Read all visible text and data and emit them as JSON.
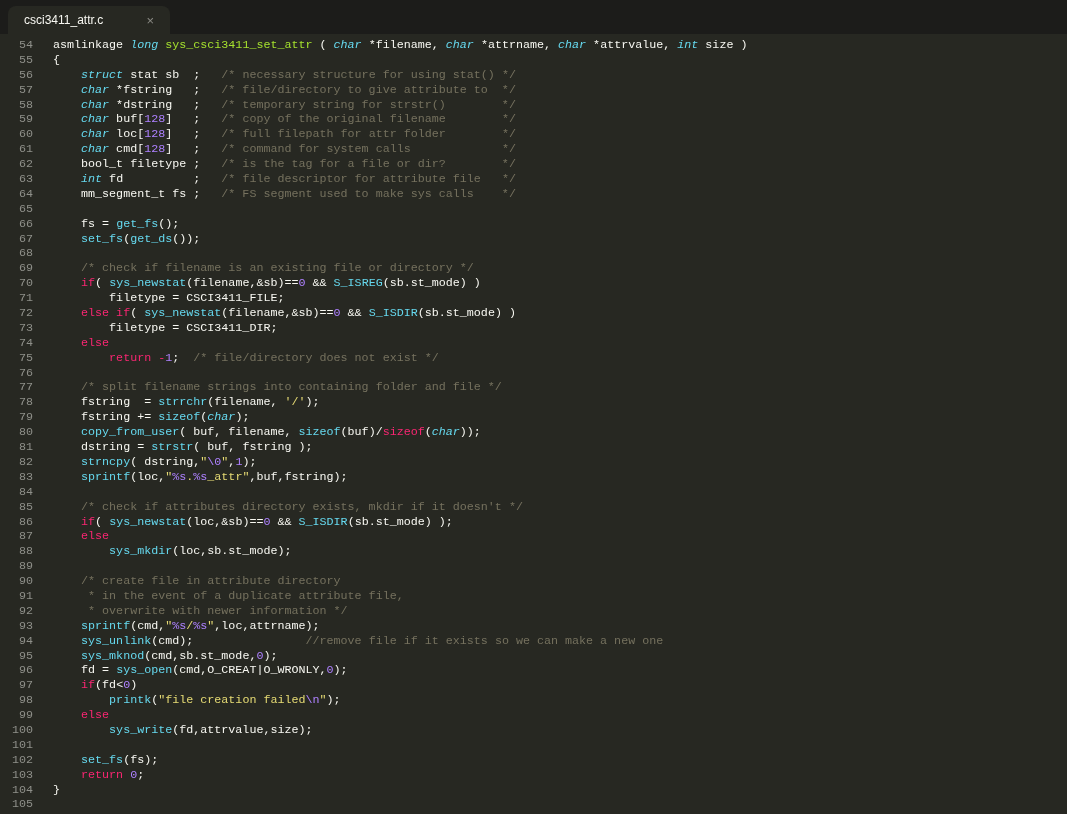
{
  "tabs": [
    {
      "label": "csci3411_attr.c",
      "close": "×",
      "selected": true
    }
  ],
  "lines": [
    {
      "number": "54",
      "tokens": [
        {
          "kind": "plain",
          "text": "asmlinkage "
        },
        {
          "kind": "storage",
          "text": "long "
        },
        {
          "kind": "entity",
          "text": "sys_csci3411_set_attr"
        },
        {
          "kind": "plain",
          "text": " ( "
        },
        {
          "kind": "storage",
          "text": "char"
        },
        {
          "kind": "plain",
          "text": " *filename, "
        },
        {
          "kind": "storage",
          "text": "char"
        },
        {
          "kind": "plain",
          "text": " *attrname, "
        },
        {
          "kind": "storage",
          "text": "char"
        },
        {
          "kind": "plain",
          "text": " *attrvalue, "
        },
        {
          "kind": "storage",
          "text": "int"
        },
        {
          "kind": "plain",
          "text": " size )"
        }
      ]
    },
    {
      "number": "55",
      "tokens": [
        {
          "kind": "plain",
          "text": "{"
        }
      ]
    },
    {
      "number": "56",
      "tokens": [
        {
          "kind": "storage",
          "text": "    struct"
        },
        {
          "kind": "plain",
          "text": " stat sb  ;   "
        },
        {
          "kind": "comment",
          "text": "/* necessary structure for using stat() */"
        }
      ]
    },
    {
      "number": "57",
      "tokens": [
        {
          "kind": "storage",
          "text": "    char"
        },
        {
          "kind": "plain",
          "text": " *fstring   ;   "
        },
        {
          "kind": "comment",
          "text": "/* file/directory to give attribute to  */"
        }
      ]
    },
    {
      "number": "58",
      "tokens": [
        {
          "kind": "storage",
          "text": "    char"
        },
        {
          "kind": "plain",
          "text": " *dstring   ;   "
        },
        {
          "kind": "comment",
          "text": "/* temporary string for strstr()        */"
        }
      ]
    },
    {
      "number": "59",
      "tokens": [
        {
          "kind": "storage",
          "text": "    char"
        },
        {
          "kind": "plain",
          "text": " buf["
        },
        {
          "kind": "number",
          "text": "128"
        },
        {
          "kind": "plain",
          "text": "]   ;   "
        },
        {
          "kind": "comment",
          "text": "/* copy of the original filename        */"
        }
      ]
    },
    {
      "number": "60",
      "tokens": [
        {
          "kind": "storage",
          "text": "    char"
        },
        {
          "kind": "plain",
          "text": " loc["
        },
        {
          "kind": "number",
          "text": "128"
        },
        {
          "kind": "plain",
          "text": "]   ;   "
        },
        {
          "kind": "comment",
          "text": "/* full filepath for attr folder        */"
        }
      ]
    },
    {
      "number": "61",
      "tokens": [
        {
          "kind": "storage",
          "text": "    char"
        },
        {
          "kind": "plain",
          "text": " cmd["
        },
        {
          "kind": "number",
          "text": "128"
        },
        {
          "kind": "plain",
          "text": "]   ;   "
        },
        {
          "kind": "comment",
          "text": "/* command for system calls             */"
        }
      ]
    },
    {
      "number": "62",
      "tokens": [
        {
          "kind": "plain",
          "text": "    bool_t filetype ;   "
        },
        {
          "kind": "comment",
          "text": "/* is the tag for a file or dir?        */"
        }
      ]
    },
    {
      "number": "63",
      "tokens": [
        {
          "kind": "storage",
          "text": "    int"
        },
        {
          "kind": "plain",
          "text": " fd          ;   "
        },
        {
          "kind": "comment",
          "text": "/* file descriptor for attribute file   */"
        }
      ]
    },
    {
      "number": "64",
      "tokens": [
        {
          "kind": "plain",
          "text": "    mm_segment_t fs ;   "
        },
        {
          "kind": "comment",
          "text": "/* FS segment used to make sys calls    */"
        }
      ]
    },
    {
      "number": "65"
    },
    {
      "number": "66",
      "tokens": [
        {
          "kind": "plain",
          "text": "    fs = "
        },
        {
          "kind": "call",
          "text": "get_fs"
        },
        {
          "kind": "plain",
          "text": "();"
        }
      ]
    },
    {
      "number": "67",
      "tokens": [
        {
          "kind": "call",
          "text": "    set_fs"
        },
        {
          "kind": "plain",
          "text": "("
        },
        {
          "kind": "call",
          "text": "get_ds"
        },
        {
          "kind": "plain",
          "text": "());"
        }
      ]
    },
    {
      "number": "68"
    },
    {
      "number": "69",
      "tokens": [
        {
          "kind": "comment",
          "text": "    /* check if filename is an existing file or directory */"
        }
      ]
    },
    {
      "number": "70",
      "tokens": [
        {
          "kind": "keyword",
          "text": "    if"
        },
        {
          "kind": "plain",
          "text": "( "
        },
        {
          "kind": "call",
          "text": "sys_newstat"
        },
        {
          "kind": "plain",
          "text": "(filename,&sb)=="
        },
        {
          "kind": "number",
          "text": "0"
        },
        {
          "kind": "plain",
          "text": " && "
        },
        {
          "kind": "call",
          "text": "S_ISREG"
        },
        {
          "kind": "plain",
          "text": "(sb.st_mode) )"
        }
      ]
    },
    {
      "number": "71",
      "tokens": [
        {
          "kind": "plain",
          "text": "        filetype = CSCI3411_FILE;"
        }
      ]
    },
    {
      "number": "72",
      "tokens": [
        {
          "kind": "keyword",
          "text": "    else if"
        },
        {
          "kind": "plain",
          "text": "( "
        },
        {
          "kind": "call",
          "text": "sys_newstat"
        },
        {
          "kind": "plain",
          "text": "(filename,&sb)=="
        },
        {
          "kind": "number",
          "text": "0"
        },
        {
          "kind": "plain",
          "text": " && "
        },
        {
          "kind": "call",
          "text": "S_ISDIR"
        },
        {
          "kind": "plain",
          "text": "(sb.st_mode) )"
        }
      ]
    },
    {
      "number": "73",
      "tokens": [
        {
          "kind": "plain",
          "text": "        filetype = CSCI3411_DIR;"
        }
      ]
    },
    {
      "number": "74",
      "tokens": [
        {
          "kind": "keyword",
          "text": "    else"
        }
      ]
    },
    {
      "number": "75",
      "tokens": [
        {
          "kind": "keyword",
          "text": "        return -"
        },
        {
          "kind": "number",
          "text": "1"
        },
        {
          "kind": "plain",
          "text": ";  "
        },
        {
          "kind": "comment",
          "text": "/* file/directory does not exist */"
        }
      ]
    },
    {
      "number": "76"
    },
    {
      "number": "77",
      "tokens": [
        {
          "kind": "comment",
          "text": "    /* split filename strings into containing folder and file */"
        }
      ]
    },
    {
      "number": "78",
      "tokens": [
        {
          "kind": "plain",
          "text": "    fstring  = "
        },
        {
          "kind": "call",
          "text": "strrchr"
        },
        {
          "kind": "plain",
          "text": "(filename, "
        },
        {
          "kind": "string",
          "text": "'/'"
        },
        {
          "kind": "plain",
          "text": ");"
        }
      ]
    },
    {
      "number": "79",
      "tokens": [
        {
          "kind": "plain",
          "text": "    fstring += "
        },
        {
          "kind": "call",
          "text": "sizeof"
        },
        {
          "kind": "plain",
          "text": "("
        },
        {
          "kind": "storage",
          "text": "char"
        },
        {
          "kind": "plain",
          "text": ");"
        }
      ]
    },
    {
      "number": "80",
      "tokens": [
        {
          "kind": "call",
          "text": "    copy_from_user"
        },
        {
          "kind": "plain",
          "text": "( buf, filename, "
        },
        {
          "kind": "call",
          "text": "sizeof"
        },
        {
          "kind": "plain",
          "text": "(buf)/"
        },
        {
          "kind": "keyword",
          "text": "sizeof"
        },
        {
          "kind": "plain",
          "text": "("
        },
        {
          "kind": "storage",
          "text": "char"
        },
        {
          "kind": "plain",
          "text": "));"
        }
      ]
    },
    {
      "number": "81",
      "tokens": [
        {
          "kind": "plain",
          "text": "    dstring = "
        },
        {
          "kind": "call",
          "text": "strstr"
        },
        {
          "kind": "plain",
          "text": "( buf, fstring );"
        }
      ]
    },
    {
      "number": "82",
      "tokens": [
        {
          "kind": "call",
          "text": "    strncpy"
        },
        {
          "kind": "plain",
          "text": "( dstring,"
        },
        {
          "kind": "string",
          "text": "\""
        },
        {
          "kind": "escape",
          "text": "\\0"
        },
        {
          "kind": "string",
          "text": "\""
        },
        {
          "kind": "plain",
          "text": ","
        },
        {
          "kind": "number",
          "text": "1"
        },
        {
          "kind": "plain",
          "text": ");"
        }
      ]
    },
    {
      "number": "83",
      "tokens": [
        {
          "kind": "call",
          "text": "    sprintf"
        },
        {
          "kind": "plain",
          "text": "(loc,"
        },
        {
          "kind": "string",
          "text": "\""
        },
        {
          "kind": "escape",
          "text": "%s"
        },
        {
          "kind": "string",
          "text": "."
        },
        {
          "kind": "escape",
          "text": "%s"
        },
        {
          "kind": "string",
          "text": "_attr\""
        },
        {
          "kind": "plain",
          "text": ",buf,fstring);"
        }
      ]
    },
    {
      "number": "84"
    },
    {
      "number": "85",
      "tokens": [
        {
          "kind": "comment",
          "text": "    /* check if attributes directory exists, mkdir if it doesn't */"
        }
      ]
    },
    {
      "number": "86",
      "tokens": [
        {
          "kind": "keyword",
          "text": "    if"
        },
        {
          "kind": "plain",
          "text": "( "
        },
        {
          "kind": "call",
          "text": "sys_newstat"
        },
        {
          "kind": "plain",
          "text": "(loc,&sb)=="
        },
        {
          "kind": "number",
          "text": "0"
        },
        {
          "kind": "plain",
          "text": " && "
        },
        {
          "kind": "call",
          "text": "S_ISDIR"
        },
        {
          "kind": "plain",
          "text": "(sb.st_mode) );"
        }
      ]
    },
    {
      "number": "87",
      "tokens": [
        {
          "kind": "keyword",
          "text": "    else"
        }
      ]
    },
    {
      "number": "88",
      "tokens": [
        {
          "kind": "call",
          "text": "        sys_mkdir"
        },
        {
          "kind": "plain",
          "text": "(loc,sb.st_mode);"
        }
      ]
    },
    {
      "number": "89"
    },
    {
      "number": "90",
      "tokens": [
        {
          "kind": "comment",
          "text": "    /* create file in attribute directory"
        }
      ]
    },
    {
      "number": "91",
      "tokens": [
        {
          "kind": "comment",
          "text": "     * in the event of a duplicate attribute file,"
        }
      ]
    },
    {
      "number": "92",
      "tokens": [
        {
          "kind": "comment",
          "text": "     * overwrite with newer information */"
        }
      ]
    },
    {
      "number": "93",
      "tokens": [
        {
          "kind": "call",
          "text": "    sprintf"
        },
        {
          "kind": "plain",
          "text": "(cmd,"
        },
        {
          "kind": "string",
          "text": "\""
        },
        {
          "kind": "escape",
          "text": "%s"
        },
        {
          "kind": "string",
          "text": "/"
        },
        {
          "kind": "escape",
          "text": "%s"
        },
        {
          "kind": "string",
          "text": "\""
        },
        {
          "kind": "plain",
          "text": ",loc,attrname);"
        }
      ]
    },
    {
      "number": "94",
      "tokens": [
        {
          "kind": "call",
          "text": "    sys_unlink"
        },
        {
          "kind": "plain",
          "text": "(cmd);                "
        },
        {
          "kind": "comment",
          "text": "//remove file if it exists so we can make a new one"
        }
      ]
    },
    {
      "number": "95",
      "tokens": [
        {
          "kind": "call",
          "text": "    sys_mknod"
        },
        {
          "kind": "plain",
          "text": "(cmd,sb.st_mode,"
        },
        {
          "kind": "number",
          "text": "0"
        },
        {
          "kind": "plain",
          "text": ");"
        }
      ]
    },
    {
      "number": "96",
      "tokens": [
        {
          "kind": "plain",
          "text": "    fd = "
        },
        {
          "kind": "call",
          "text": "sys_open"
        },
        {
          "kind": "plain",
          "text": "(cmd,O_CREAT|O_WRONLY,"
        },
        {
          "kind": "number",
          "text": "0"
        },
        {
          "kind": "plain",
          "text": ");"
        }
      ]
    },
    {
      "number": "97",
      "tokens": [
        {
          "kind": "keyword",
          "text": "    if"
        },
        {
          "kind": "plain",
          "text": "(fd<"
        },
        {
          "kind": "number",
          "text": "0"
        },
        {
          "kind": "plain",
          "text": ")"
        }
      ]
    },
    {
      "number": "98",
      "tokens": [
        {
          "kind": "call",
          "text": "        printk"
        },
        {
          "kind": "plain",
          "text": "("
        },
        {
          "kind": "string",
          "text": "\"file creation failed"
        },
        {
          "kind": "escape",
          "text": "\\n"
        },
        {
          "kind": "string",
          "text": "\""
        },
        {
          "kind": "plain",
          "text": ");"
        }
      ]
    },
    {
      "number": "99",
      "tokens": [
        {
          "kind": "keyword",
          "text": "    else"
        }
      ]
    },
    {
      "number": "100",
      "tokens": [
        {
          "kind": "call",
          "text": "        sys_write"
        },
        {
          "kind": "plain",
          "text": "(fd,attrvalue,size);"
        }
      ]
    },
    {
      "number": "101"
    },
    {
      "number": "102",
      "tokens": [
        {
          "kind": "call",
          "text": "    set_fs"
        },
        {
          "kind": "plain",
          "text": "(fs);"
        }
      ]
    },
    {
      "number": "103",
      "tokens": [
        {
          "kind": "keyword",
          "text": "    return "
        },
        {
          "kind": "number",
          "text": "0"
        },
        {
          "kind": "plain",
          "text": ";"
        }
      ]
    },
    {
      "number": "104",
      "tokens": [
        {
          "kind": "plain",
          "text": "}"
        }
      ]
    },
    {
      "number": "105"
    }
  ]
}
